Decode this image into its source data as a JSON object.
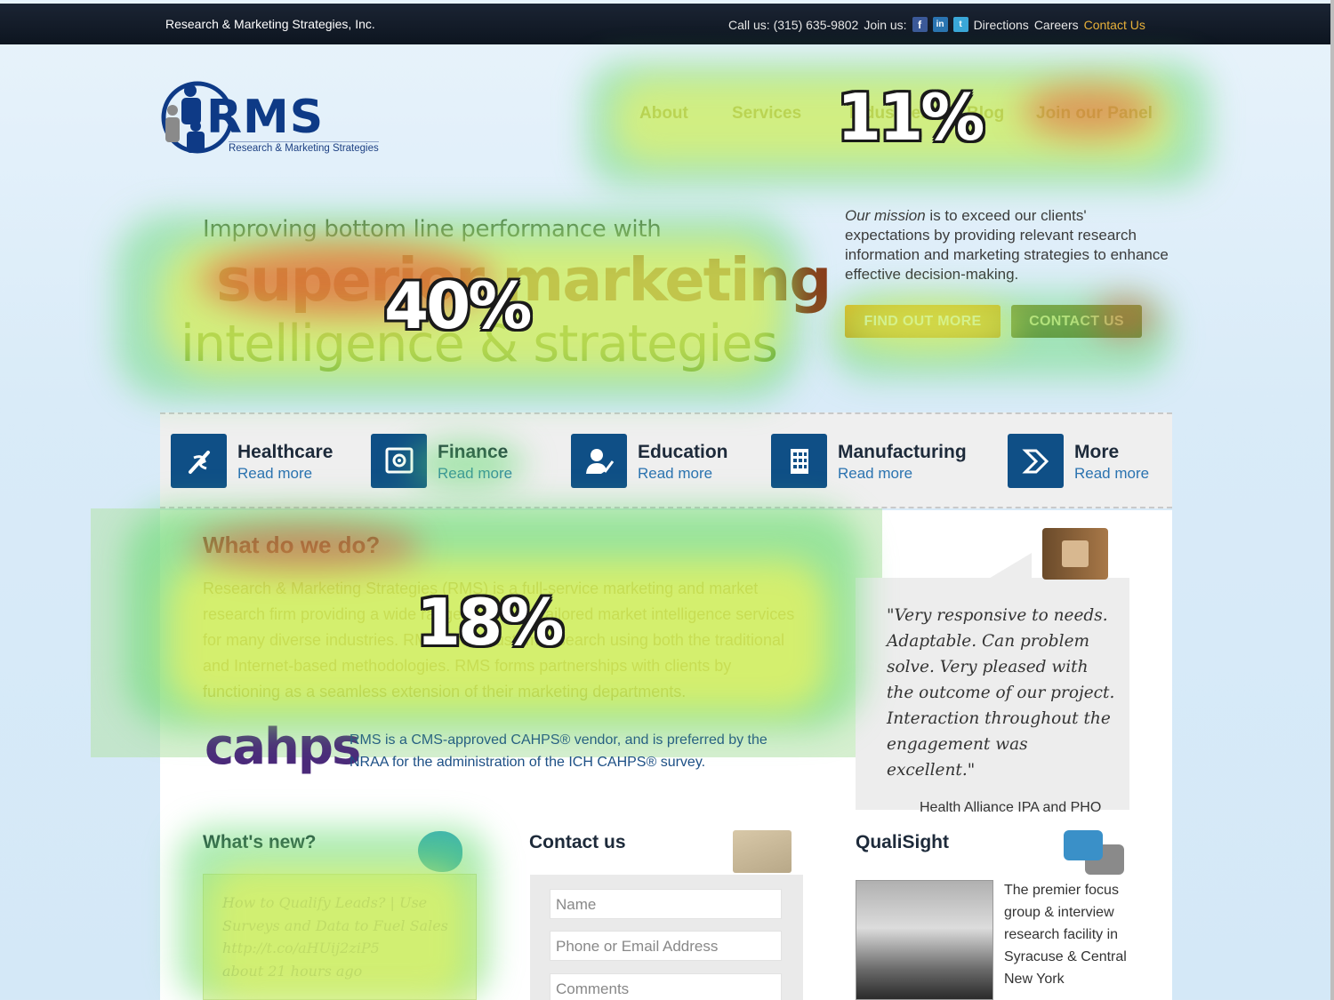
{
  "topbar": {
    "company": "Research & Marketing Strategies, Inc.",
    "call_us": "Call us: (315) 635-9802",
    "join_us": "Join us:",
    "social": [
      "facebook-icon",
      "linkedin-icon",
      "twitter-icon"
    ],
    "links": [
      "Directions",
      "Careers",
      "Contact Us"
    ]
  },
  "logo": {
    "name": "RMS",
    "subtitle": "Research & Marketing Strategies"
  },
  "nav": [
    "About",
    "Services",
    "Industries",
    "Blog",
    "Join our Panel"
  ],
  "hero": {
    "line1": "Improving bottom line performance with",
    "line2": "superior marketing",
    "line3": "intelligence & strategies"
  },
  "mission": {
    "lead": "Our mission",
    "text": " is to exceed our clients' expectations by providing relevant research information and marketing strategies to enhance effective decision-making."
  },
  "buttons": {
    "find_out_more": "FIND OUT MORE",
    "contact_us": "CONTACT US"
  },
  "categories": [
    {
      "title": "Healthcare",
      "more": "Read more",
      "icon": "healthcare-icon"
    },
    {
      "title": "Finance",
      "more": "Read more",
      "icon": "safe-icon"
    },
    {
      "title": "Education",
      "more": "Read more",
      "icon": "student-icon"
    },
    {
      "title": "Manufacturing",
      "more": "Read more",
      "icon": "building-icon"
    },
    {
      "title": "More",
      "more": "Read more",
      "icon": "arrow-icon"
    }
  ],
  "whatwedo": {
    "title": "What do we do?",
    "body": "Research & Marketing Strategies (RMS) is a full-service marketing and market research firm providing a wide range of custom-tailored market intelligence services for many diverse industries. RMS offers custom research using both the traditional and Internet-based methodologies. RMS forms partnerships with clients by functioning as a seamless extension of their marketing departments."
  },
  "cahps": {
    "logo": "cahps",
    "text": "RMS is a CMS-approved CAHPS® vendor, and is preferred by the NRAA for the administration of the ICH CAHPS® survey."
  },
  "testimonial": {
    "quote": "\"Very responsive to needs. Adaptable. Can problem solve. Very pleased with the outcome of our project. Interaction throughout the engagement was excellent.\"",
    "author": "Health Alliance IPA and PHO"
  },
  "whatsnew": {
    "title": "What's new?",
    "tweet": "How to Qualify Leads? | Use Surveys and Data to Fuel Sales http://t.co/aHUij2ziP5",
    "time": "about 21 hours ago"
  },
  "contact": {
    "title": "Contact us",
    "name_placeholder": "Name",
    "phone_placeholder": "Phone or Email Address",
    "comments_placeholder": "Comments"
  },
  "qualisight": {
    "title": "QualiSight",
    "text": "The premier focus group & interview research facility in Syracuse & Central New York"
  },
  "heatmap": {
    "nav_pct": "11%",
    "hero_pct": "40%",
    "about_pct": "18%"
  },
  "colors": {
    "heat_red": "#e83a2a",
    "heat_yellow": "#f4f455",
    "heat_green": "#5cd96a",
    "brand_blue": "#0f4f86",
    "accent_orange": "#f0a012"
  }
}
